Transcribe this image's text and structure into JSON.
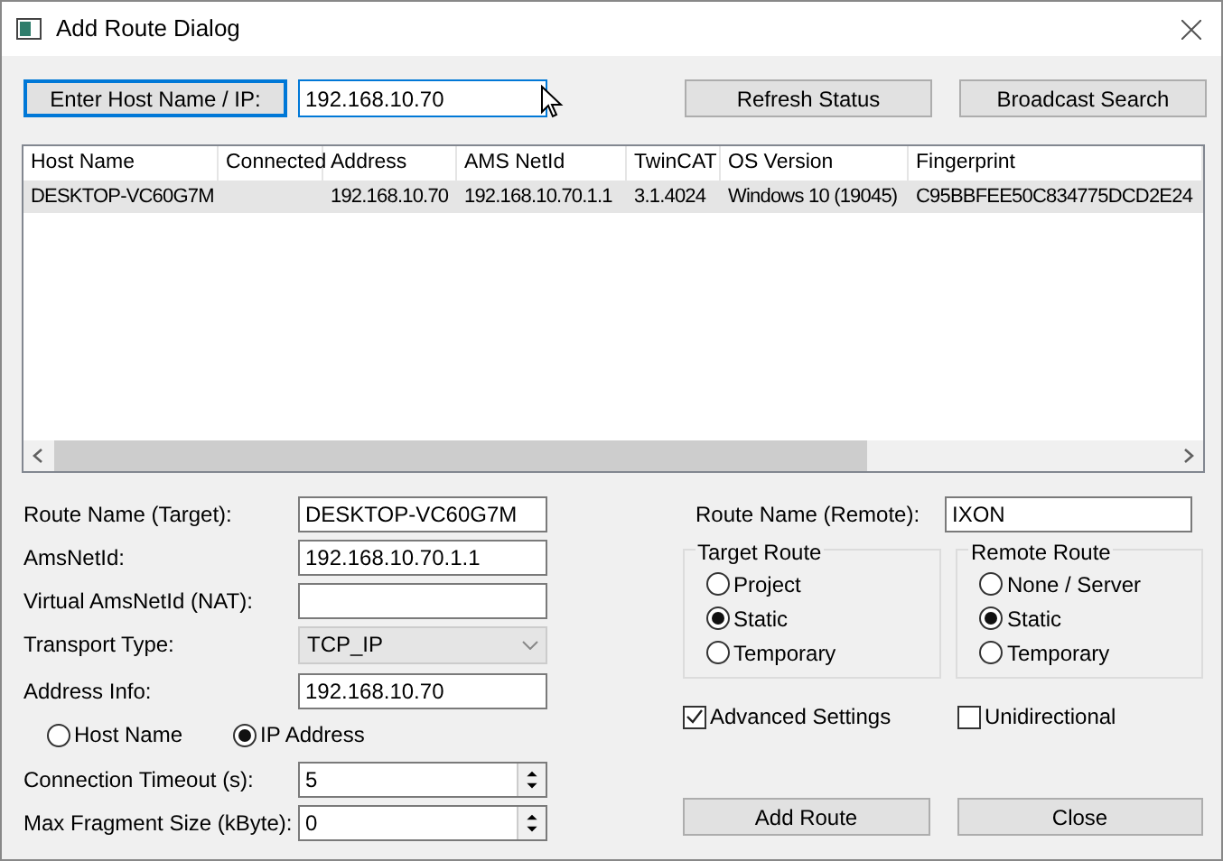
{
  "window": {
    "title": "Add Route Dialog"
  },
  "toolbar": {
    "host_button": "Enter Host Name / IP:",
    "host_input": "192.168.10.70",
    "buttons": [
      "Refresh Status",
      "Broadcast Search"
    ]
  },
  "table": {
    "columns": [
      "Host Name",
      "Connected",
      "Address",
      "AMS NetId",
      "TwinCAT",
      "OS Version",
      "Fingerprint"
    ],
    "rows": [
      {
        "selected": true,
        "cells": [
          "DESKTOP-VC60G7M",
          "",
          "192.168.10.70",
          "192.168.10.70.1.1",
          "3.1.4024",
          "Windows 10 (19045)",
          "C95BBFEE50C834775DCD2E24"
        ]
      }
    ]
  },
  "left_form": [
    {
      "kind": "text",
      "label": "Route Name (Target):",
      "value": "DESKTOP-VC60G7M"
    },
    {
      "kind": "text",
      "label": "AmsNetId:",
      "value": "192.168.10.70.1.1"
    },
    {
      "kind": "text",
      "label": "Virtual AmsNetId (NAT):"
    },
    {
      "kind": "select",
      "label": "Transport Type:",
      "value": "TCP_IP"
    },
    {
      "kind": "text",
      "label": "Address Info:",
      "value": "192.168.10.70"
    },
    {
      "kind": "radios",
      "options": [
        {
          "label": "Host Name",
          "selected": false
        },
        {
          "label": "IP Address",
          "selected": true
        }
      ]
    },
    {
      "kind": "spin",
      "label": "Connection Timeout (s):",
      "value": "5"
    },
    {
      "kind": "spin",
      "label": "Max Fragment Size (kByte):",
      "value": "0"
    }
  ],
  "remote_name": {
    "label": "Route Name (Remote):",
    "value": "IXON"
  },
  "groups": [
    {
      "title": "Target Route",
      "options": [
        {
          "label": "Project",
          "selected": false
        },
        {
          "label": "Static",
          "selected": true
        },
        {
          "label": "Temporary",
          "selected": false
        }
      ]
    },
    {
      "title": "Remote Route",
      "options": [
        {
          "label": "None / Server",
          "selected": false
        },
        {
          "label": "Static",
          "selected": true
        },
        {
          "label": "Temporary",
          "selected": false
        }
      ]
    }
  ],
  "checkboxes": [
    {
      "label": "Advanced Settings",
      "checked": true
    },
    {
      "label": "Unidirectional",
      "checked": false
    }
  ],
  "buttons": [
    "Add Route",
    "Close"
  ]
}
